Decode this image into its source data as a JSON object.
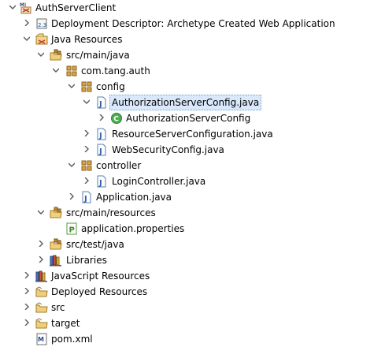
{
  "tree": {
    "project": {
      "label": "AuthServerClient"
    },
    "deployment_descriptor": {
      "label": "Deployment Descriptor: Archetype Created Web Application"
    },
    "java_resources": {
      "label": "Java Resources"
    },
    "src_main_java": {
      "label": "src/main/java"
    },
    "package_auth": {
      "label": "com.tang.auth"
    },
    "package_config": {
      "label": "config"
    },
    "authorization_server_config_java": {
      "label": "AuthorizationServerConfig.java"
    },
    "authorization_server_config_class": {
      "label": "AuthorizationServerConfig"
    },
    "resource_server_configuration_java": {
      "label": "ResourceServerConfiguration.java"
    },
    "web_security_config_java": {
      "label": "WebSecurityConfig.java"
    },
    "package_controller": {
      "label": "controller"
    },
    "login_controller_java": {
      "label": "LoginController.java"
    },
    "application_java": {
      "label": "Application.java"
    },
    "src_main_resources": {
      "label": "src/main/resources"
    },
    "application_properties": {
      "label": "application.properties"
    },
    "src_test_java": {
      "label": "src/test/java"
    },
    "libraries": {
      "label": "Libraries"
    },
    "javascript_resources": {
      "label": "JavaScript Resources"
    },
    "deployed_resources": {
      "label": "Deployed Resources"
    },
    "src_folder": {
      "label": "src"
    },
    "target_folder": {
      "label": "target"
    },
    "pom_xml": {
      "label": "pom.xml"
    }
  },
  "colors": {
    "selection": "#d9e8fb",
    "arrow": "#5a5a5a",
    "package": "#b5862d",
    "java_file": "#3a6ea5",
    "class_green": "#3f9b3f"
  }
}
